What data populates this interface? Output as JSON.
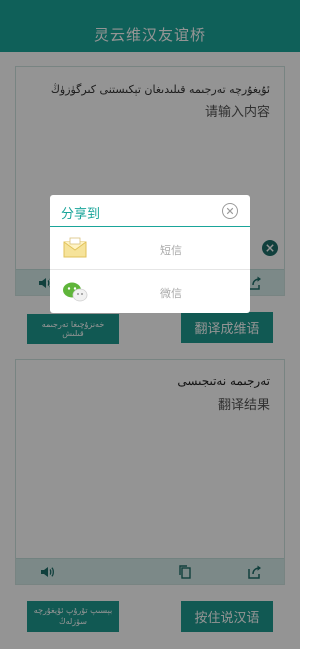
{
  "header": {
    "title": "灵云维汉友谊桥"
  },
  "top_panel": {
    "uyghur_placeholder": "ئۇيغۇرچە تەرجىمە قىلىدىغان تېكىستنى كىرگۈزۈڭ",
    "chinese_placeholder": "请输入内容"
  },
  "bottom_panel": {
    "uyghur_label": "تەرجىمە نەتىجىسى",
    "chinese_label": "翻译结果"
  },
  "buttons": {
    "translate_uyghur": "خەنزۇچىغا تەرجىمە قىلىش",
    "translate_chinese": "翻译成维语",
    "hold_speak_uyghur": "بېسىپ تۇرۇپ ئۇيغۇرچە سۆزلەڭ",
    "hold_speak_chinese": "按住说汉语"
  },
  "share_dialog": {
    "title": "分享到",
    "options": [
      {
        "label": "短信",
        "icon": "sms-envelope-icon"
      },
      {
        "label": "微信",
        "icon": "wechat-icon"
      }
    ]
  },
  "colors": {
    "accent": "#1aa59a",
    "button": "#1e9a90",
    "toolbar": "#d6ecea"
  }
}
